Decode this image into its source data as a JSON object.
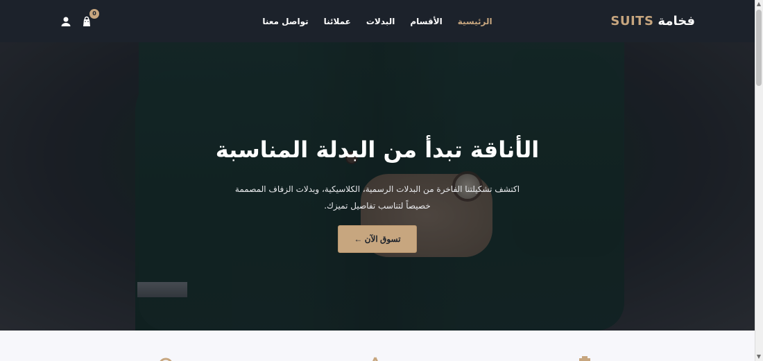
{
  "brand": {
    "name": "فخامة",
    "accent": "SUITS"
  },
  "nav": {
    "items": [
      {
        "label": "الرئيسية",
        "active": true
      },
      {
        "label": "الأقسام",
        "active": false
      },
      {
        "label": "البدلات",
        "active": false
      },
      {
        "label": "عملائنا",
        "active": false
      },
      {
        "label": "تواصل معنا",
        "active": false
      }
    ]
  },
  "header_icons": {
    "cart_count": "0",
    "cart_icon": "shopping-bag-icon",
    "user_icon": "user-icon"
  },
  "hero": {
    "title": "الأناقة تبدأ من البدلة المناسبة",
    "description": "اكتشف تشكيلتنا الفاخرة من البدلات الرسمية، الكلاسيكية، وبدلات الزفاف المصممة خصيصاً لتناسب تفاصيل تميزك.",
    "cta_label": "تسوق الآن ←"
  },
  "colors": {
    "accent": "#c7a67f",
    "navbar": "#1c222b"
  }
}
